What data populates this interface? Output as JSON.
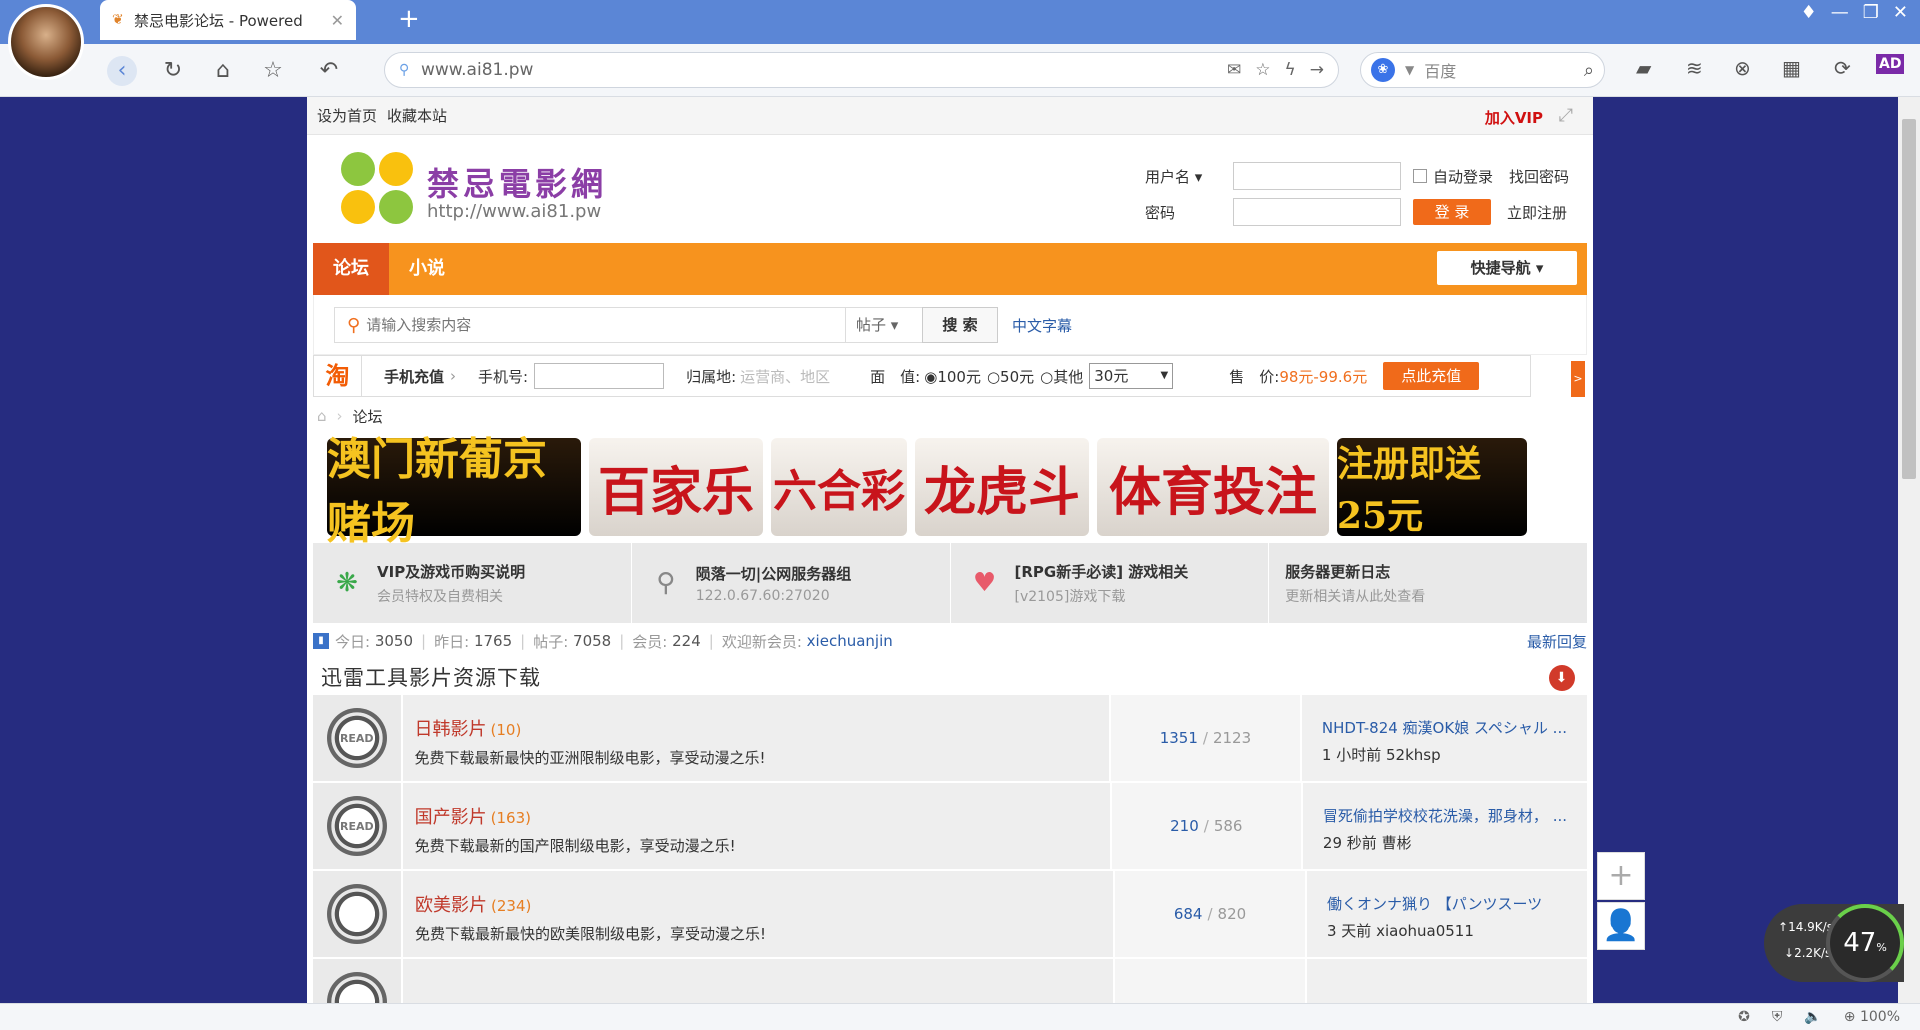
{
  "browser": {
    "tab_title": "禁忌电影论坛 - Powered",
    "url": "www.ai81.pw",
    "search_placeholder": "百度",
    "zoom": "100%"
  },
  "topline": {
    "set_home": "设为首页",
    "bookmark": "收藏本站",
    "vip": "加入VIP"
  },
  "logo": {
    "name": "禁忌電影網",
    "url": "http://www.ai81.pw"
  },
  "login": {
    "username_label": "用户名",
    "password_label": "密码",
    "auto_login": "自动登录",
    "find_password": "找回密码",
    "login_btn": "登 录",
    "register": "立即注册"
  },
  "nav": {
    "items": [
      "论坛",
      "小说"
    ],
    "quick": "快捷导航"
  },
  "search": {
    "placeholder": "请输入搜索内容",
    "type": "帖子",
    "btn": "搜 索",
    "hot": "中文字幕"
  },
  "recharge": {
    "logo": "淘",
    "title": "手机充值",
    "phone_label": "手机号:",
    "region_label": "归属地:",
    "region_hint": "运营商、地区",
    "face_label": "面　值:",
    "opt1": "100元",
    "opt2": "50元",
    "opt3": "其他",
    "amount": "30元",
    "sell_label": "售　价:",
    "price": "98元-99.6元",
    "pay_btn": "点此充值"
  },
  "breadcrumb": {
    "current": "论坛"
  },
  "banners": [
    "澳门新葡京赌场",
    "百家乐",
    "六合彩",
    "龙虎斗",
    "体育投注",
    "注册即送25元"
  ],
  "info": [
    {
      "title": "VIP及游戏币购买说明",
      "sub": "会员特权及自费相关"
    },
    {
      "title": "陨落一切|公网服务器组",
      "sub": "122.0.67.60:27020"
    },
    {
      "title": "[RPG新手必读] 游戏相关",
      "sub": "[v2105]游戏下载"
    },
    {
      "title": "服务器更新日志",
      "sub": "更新相关请从此处查看"
    }
  ],
  "stats": {
    "today_label": "今日:",
    "today": "3050",
    "yesterday_label": "昨日:",
    "yesterday": "1765",
    "posts_label": "帖子:",
    "posts": "7058",
    "members_label": "会员:",
    "members": "224",
    "welcome_label": "欢迎新会员:",
    "newest": "xiechuanjin",
    "latest": "最新回复"
  },
  "category": {
    "title": "迅雷工具影片资源下载"
  },
  "forums": [
    {
      "icon": "READ",
      "name": "日韩影片",
      "count": "(10)",
      "desc": "免费下载最新最快的亚洲限制级电影，享受动漫之乐!",
      "threads": "1351",
      "posts": "2123",
      "last_title": "NHDT-824 痴漢OK娘 スペシャル ...",
      "last_time": "1 小时前",
      "last_user": "52khsp"
    },
    {
      "icon": "READ",
      "name": "国产影片",
      "count": "(163)",
      "desc": "免费下载最新的国产限制级电影，享受动漫之乐!",
      "threads": "210",
      "posts": "586",
      "last_title": "冒死偷拍学校校花洗澡，那身材， ...",
      "last_time": "29 秒前",
      "last_user": "曹彬"
    },
    {
      "icon": "",
      "name": "欧美影片",
      "count": "(234)",
      "desc": "免费下载最新最快的欧美限制级电影，享受动漫之乐!",
      "threads": "684",
      "posts": "820",
      "last_title": "働くオンナ猟り 【パンツスーツ",
      "last_time": "3 天前",
      "last_user": "xiaohua0511"
    }
  ],
  "speed": {
    "up": "14.9K/s",
    "down": "2.2K/s",
    "cpu": "47"
  }
}
